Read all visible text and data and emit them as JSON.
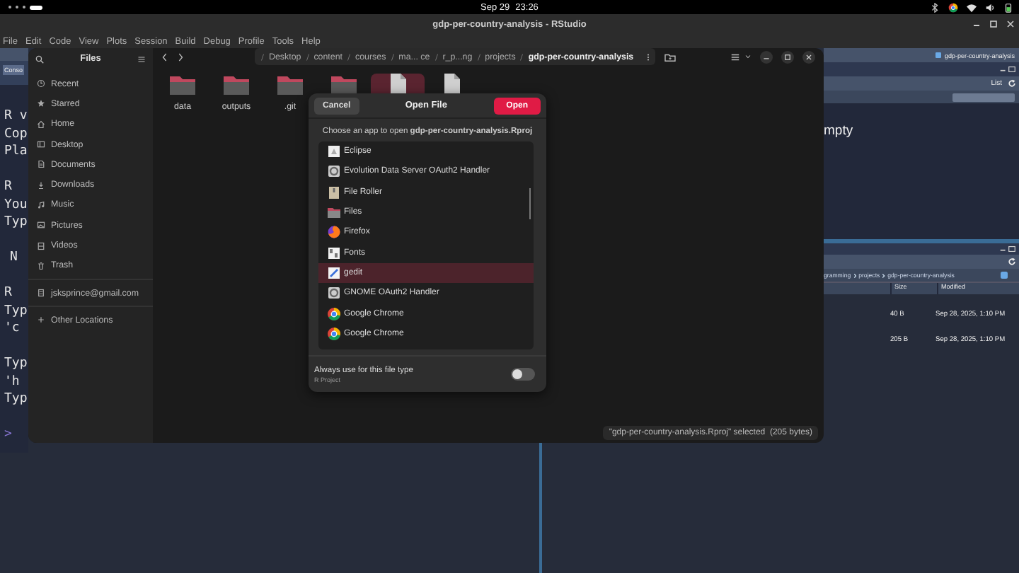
{
  "top_bar": {
    "date": "Sep 29",
    "time": "23:26"
  },
  "rstudio": {
    "title": "gdp-per-country-analysis - RStudio",
    "menu": [
      "File",
      "Edit",
      "Code",
      "View",
      "Plots",
      "Session",
      "Build",
      "Debug",
      "Profile",
      "Tools",
      "Help"
    ],
    "console": {
      "tab": "Conso",
      "blocks": [
        {
          "lines": [
            "R v",
            "Cop",
            "Pla"
          ],
          "indented": false
        },
        {
          "lines": [
            "R",
            "You",
            "Typ"
          ],
          "indented": false
        },
        {
          "lines": [
            "N"
          ],
          "indented": true
        },
        {
          "lines": [
            "R",
            "Typ",
            "'c"
          ],
          "indented": false
        },
        {
          "lines": [
            "Typ",
            "'h",
            "Typ"
          ],
          "indented": false
        }
      ],
      "prompt": ">"
    },
    "environment": {
      "project": "gdp-per-country-analysis",
      "view_mode": "List",
      "message": "mpty"
    },
    "files_pane": {
      "breadcrumb": [
        "gramming",
        "projects",
        "gdp-per-country-analysis"
      ],
      "columns": [
        "Size",
        "Modified"
      ],
      "rows": [
        {
          "size": "40 B",
          "modified": "Sep 28, 2025, 1:10 PM"
        },
        {
          "size": "205 B",
          "modified": "Sep 28, 2025, 1:10 PM"
        }
      ]
    }
  },
  "files_window": {
    "title": "Files",
    "sidebar": [
      [
        {
          "label": "Recent",
          "kind": "recent"
        },
        {
          "label": "Starred",
          "kind": "starred"
        },
        {
          "label": "Home",
          "kind": "home"
        },
        {
          "label": "Desktop",
          "kind": "desktop"
        },
        {
          "label": "Documents",
          "kind": "documents"
        },
        {
          "label": "Downloads",
          "kind": "downloads"
        },
        {
          "label": "Music",
          "kind": "music"
        },
        {
          "label": "Pictures",
          "kind": "pictures"
        },
        {
          "label": "Videos",
          "kind": "videos"
        },
        {
          "label": "Trash",
          "kind": "trash"
        }
      ],
      [
        {
          "label": "jsksprince@gmail.com",
          "kind": "account"
        }
      ],
      [
        {
          "label": "Other Locations",
          "kind": "other"
        }
      ]
    ],
    "path": [
      "Desktop",
      "content",
      "courses",
      "ma... ce",
      "r_p...ng",
      "projects",
      "gdp-per-country-analysis"
    ],
    "items": [
      {
        "name": "data",
        "kind": "folder",
        "selected": false
      },
      {
        "name": "outputs",
        "kind": "folder",
        "selected": false
      },
      {
        "name": ".git",
        "kind": "folder",
        "selected": false
      },
      {
        "kind": "folder",
        "selected": false
      },
      {
        "kind": "file",
        "selected": true
      },
      {
        "kind": "file",
        "selected": false
      }
    ],
    "status": "\"gdp-per-country-analysis.Rproj\" selected  (205 bytes)"
  },
  "dialog": {
    "title": "Open File",
    "cancel": "Cancel",
    "open": "Open",
    "prompt": "Choose an app to open **gdp-per-country-analysis.Rproj**",
    "apps": [
      {
        "name": "Eclipse",
        "kind": "document",
        "selected": false
      },
      {
        "name": "Evolution Data Server OAuth2 Handler",
        "kind": "gear",
        "selected": false
      },
      {
        "name": "File Roller",
        "kind": "archive",
        "selected": false
      },
      {
        "name": "Files",
        "kind": "folder",
        "selected": false
      },
      {
        "name": "Firefox",
        "kind": "fox",
        "selected": false
      },
      {
        "name": "Fonts",
        "kind": "font",
        "selected": false
      },
      {
        "name": "gedit",
        "kind": "pen",
        "selected": true
      },
      {
        "name": "GNOME OAuth2 Handler",
        "kind": "gear",
        "selected": false
      },
      {
        "name": "Google Chrome",
        "kind": "browser",
        "selected": false
      },
      {
        "name": "Google Chrome",
        "kind": "browser",
        "selected": false
      }
    ],
    "always_use": {
      "label": "Always use for this file type",
      "sublabel": "R Project",
      "on": false
    }
  }
}
